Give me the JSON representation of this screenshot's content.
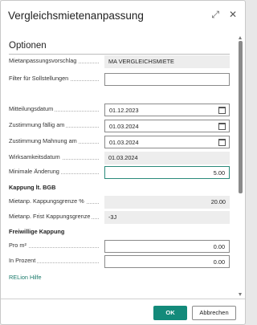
{
  "dialog": {
    "title": "Vergleichsmietenanpassung",
    "expand_icon": "expand-icon",
    "close_icon": "close-icon"
  },
  "section": {
    "title": "Optionen"
  },
  "fields": [
    {
      "label": "Mietanpassungsvorschlag",
      "value": "MA VERGLEICHSMIETE",
      "kind": "readonly"
    },
    {
      "label": "Filter für Sollstellungen",
      "value": "",
      "kind": "input"
    },
    {
      "label": "Mitteilungsdatum",
      "value": "01.12.2023",
      "kind": "date"
    },
    {
      "label": "Zustimmung fällig am",
      "value": "01.03.2024",
      "kind": "date"
    },
    {
      "label": "Zustimmung Mahnung am",
      "value": "01.03.2024",
      "kind": "date"
    },
    {
      "label": "Wirksamkeitsdatum",
      "value": "01.03.2024",
      "kind": "readonly"
    },
    {
      "label": "Minimale Änderung",
      "value": "5.00",
      "kind": "number-focus"
    }
  ],
  "kappung_bgb": {
    "heading": "Kappung lt. BGB",
    "fields": [
      {
        "label": "Mietanp. Kappungsgrenze %",
        "value": "20.00"
      },
      {
        "label": "Mietanp. Frist Kappungsgrenze",
        "value": "-3J"
      }
    ]
  },
  "freiwillige": {
    "heading": "Freiwillige Kappung",
    "fields": [
      {
        "label": "Pro m²",
        "value": "0.00"
      },
      {
        "label": "In Prozent",
        "value": "0.00"
      }
    ]
  },
  "help_link": "RELion Hilfe",
  "buttons": {
    "ok": "OK",
    "cancel": "Abbrechen"
  },
  "colors": {
    "accent": "#138a7a",
    "focus_border": "#2a8a7a",
    "readonly_bg": "#ededed"
  }
}
